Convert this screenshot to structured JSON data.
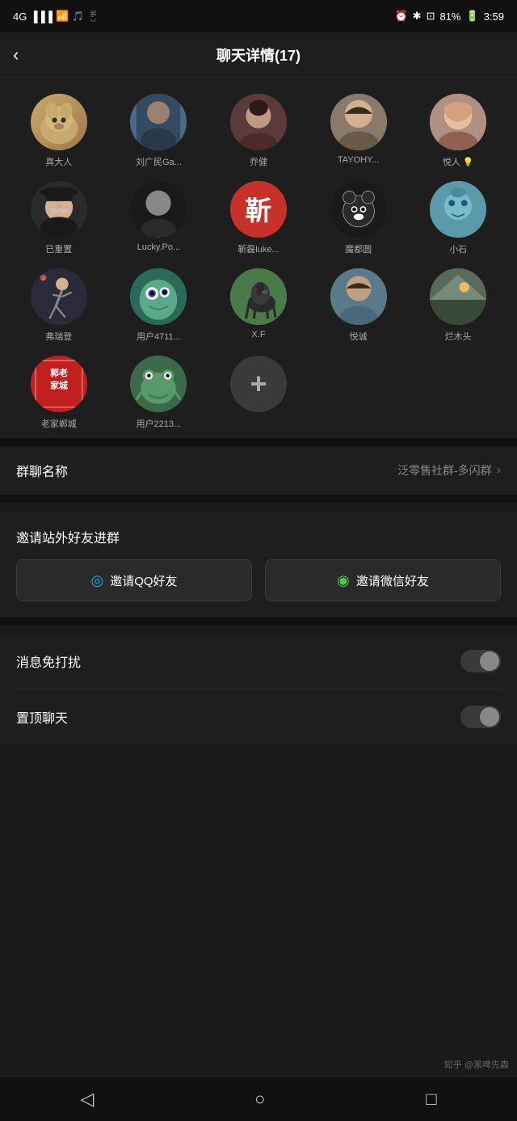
{
  "statusBar": {
    "signal": "4G",
    "wifi": "📶",
    "battery": "81%",
    "time": "3:59",
    "icons": [
      "alarm",
      "bluetooth",
      "screenshot",
      "battery"
    ]
  },
  "header": {
    "backLabel": "‹",
    "title": "聊天详情(17)"
  },
  "members": [
    {
      "id": 1,
      "name": "真大人",
      "avatarClass": "dog",
      "emoji": "🐕"
    },
    {
      "id": 2,
      "name": "刘广民Ga...",
      "avatarClass": "person1",
      "emoji": "👤"
    },
    {
      "id": 3,
      "name": "乔健",
      "avatarClass": "person2",
      "emoji": "👤"
    },
    {
      "id": 4,
      "name": "TAYOHY...",
      "avatarClass": "lady1",
      "emoji": "👤"
    },
    {
      "id": 5,
      "name": "悦人 💡",
      "avatarClass": "lady2",
      "emoji": "👤"
    },
    {
      "id": 6,
      "name": "已重置",
      "avatarClass": "hat",
      "emoji": "🎩"
    },
    {
      "id": 7,
      "name": "Lucky.Po...",
      "avatarClass": "tiktok",
      "emoji": "🎵"
    },
    {
      "id": 8,
      "name": "靳磊luke...",
      "avatarClass": "chinese-char",
      "text": "靳"
    },
    {
      "id": 9,
      "name": "魔都圆",
      "avatarClass": "bear",
      "emoji": "🐻"
    },
    {
      "id": 10,
      "name": "小石",
      "avatarClass": "blue-char",
      "emoji": "🐙"
    },
    {
      "id": 11,
      "name": "弗瑞登",
      "avatarClass": "runner",
      "emoji": "🏃"
    },
    {
      "id": 12,
      "name": "用户4711...",
      "avatarClass": "monster",
      "emoji": "👾"
    },
    {
      "id": 13,
      "name": "X.F",
      "avatarClass": "horse",
      "emoji": "🐎"
    },
    {
      "id": 14,
      "name": "悦诚",
      "avatarClass": "person3",
      "emoji": "👤"
    },
    {
      "id": 15,
      "name": "烂木头",
      "avatarClass": "outdoor",
      "emoji": "🌄"
    },
    {
      "id": 16,
      "name": "老家郸城",
      "avatarClass": "red-seal",
      "text": "郭老城"
    },
    {
      "id": 17,
      "name": "用户2213...",
      "avatarClass": "green-frog",
      "emoji": "🐸"
    }
  ],
  "settings": {
    "groupName": {
      "label": "群聊名称",
      "value": "泛零售社群-多闪群",
      "chevron": "›"
    }
  },
  "invite": {
    "title": "邀请站外好友进群",
    "qqButton": "邀请QQ好友",
    "wxButton": "邀请微信好友"
  },
  "toggles": [
    {
      "label": "消息免打扰",
      "enabled": false
    },
    {
      "label": "置顶聊天",
      "enabled": false
    }
  ],
  "bottomNav": {
    "back": "◁",
    "home": "○",
    "recents": "□"
  },
  "watermark": "知乎 @黑啤先森",
  "addButton": "+"
}
